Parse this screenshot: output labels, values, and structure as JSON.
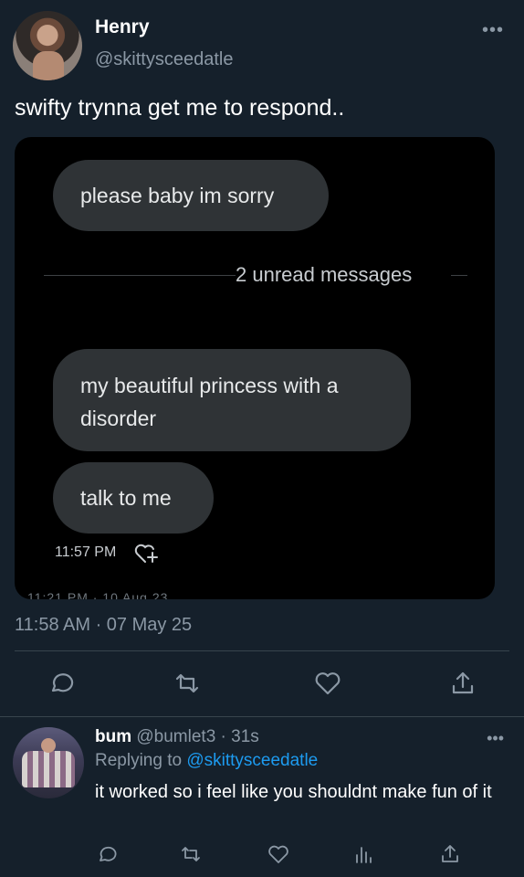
{
  "tweet": {
    "author_name": "Henry",
    "author_handle": "@skittysceedatle",
    "text": "swifty trynna get me to respond..",
    "timestamp": "11:58 AM · 07 May 25",
    "more_icon": "more-horizontal-icon"
  },
  "screenshot": {
    "bubble1": "please baby im sorry",
    "unread_divider": "2 unread messages",
    "bubble2": "my beautiful princess with a disorder",
    "bubble3": "talk to me",
    "message_time": "11:57 PM",
    "cutoff_text": "11:21 PM · 10 Aug 23"
  },
  "actions": [
    "reply-icon",
    "retweet-icon",
    "like-icon",
    "share-icon"
  ],
  "reply": {
    "name": "bum",
    "meta": "@bumlet3 · 31s",
    "replying_label": "Replying to",
    "replying_to": "@skittysceedatle",
    "text": "it worked so i feel like you shouldnt make fun of it",
    "actions": [
      "reply-icon",
      "retweet-icon",
      "like-icon",
      "views-icon",
      "share-icon"
    ]
  },
  "colors": {
    "background": "#15202b",
    "secondary_text": "#8b98a5",
    "link": "#1d9bf0",
    "bubble": "#2f3336"
  }
}
